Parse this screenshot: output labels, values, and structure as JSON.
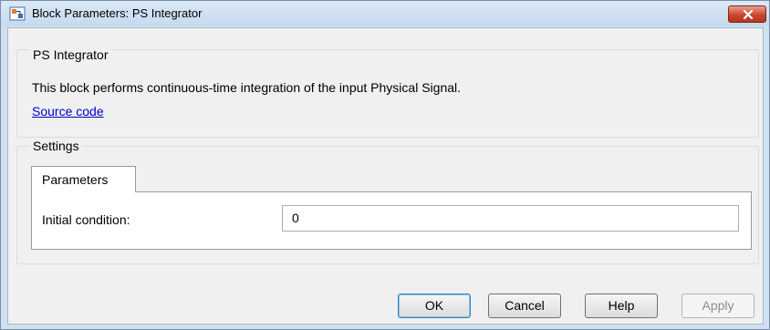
{
  "window": {
    "title": "Block Parameters: PS Integrator"
  },
  "description_group": {
    "title": "PS Integrator",
    "description": "This block performs continuous-time integration of the input Physical Signal.",
    "link_text": "Source code"
  },
  "settings_group": {
    "title": "Settings",
    "tabs": [
      {
        "label": "Parameters",
        "selected": true
      }
    ],
    "fields": [
      {
        "label": "Initial condition:",
        "value": "0"
      }
    ]
  },
  "buttons": {
    "ok": "OK",
    "cancel": "Cancel",
    "help": "Help",
    "apply": "Apply",
    "apply_enabled": false
  },
  "icons": {
    "title_icon": "simulink-block-icon",
    "close": "close-icon"
  },
  "colors": {
    "titlebar": "#c6d9ef",
    "close_button": "#c9462c",
    "link": "#0000cc"
  }
}
